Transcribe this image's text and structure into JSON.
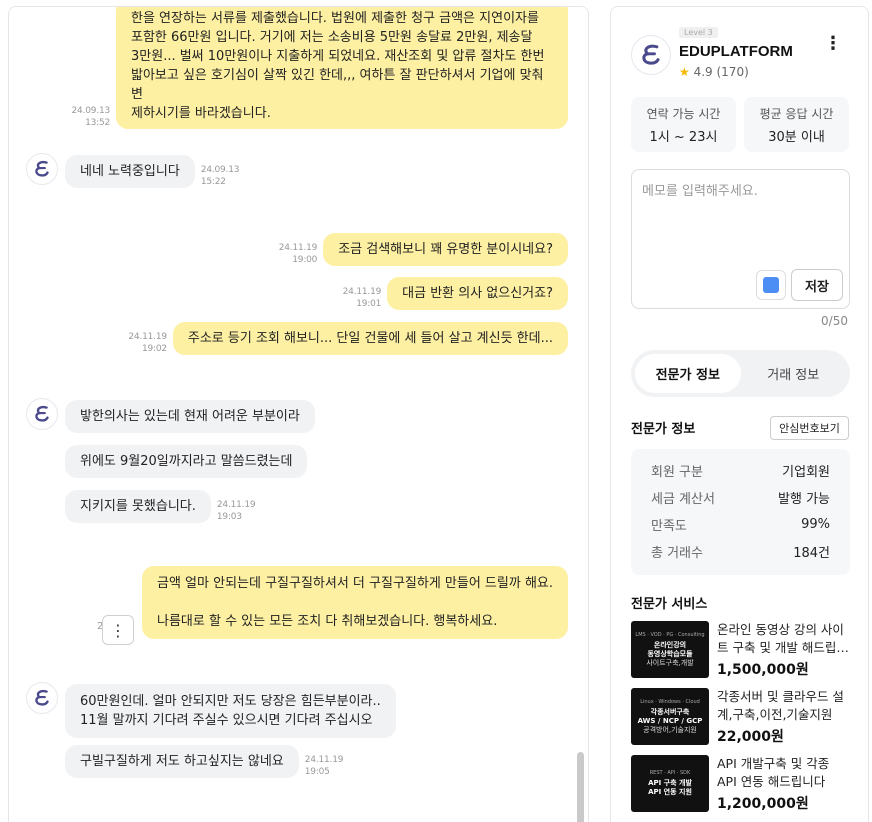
{
  "chat": {
    "messages": [
      {
        "text": "한을 연장하는 서류를 제출했습니다. 법원에 제출한 청구 금액은 지연이자를\n포함한 66만원 입니다. 거기에 저는 소송비용 5만원 송달료 2만원, 제송달\n3만원... 벌써 10만원이나 지출하게 되었네요. 재산조회 및 압류 절차도 한번\n밟아보고 싶은 호기심이 살짝 있긴 한데,,, 여하튼 잘 판단하셔서 기업에 맞춰 변\n제하시기를 바라겠습니다.",
        "date": "24.09.13",
        "time": "13:52"
      },
      {
        "text": "네네 노력중입니다",
        "date": "24.09.13",
        "time": "15:22"
      },
      {
        "text": "조금 검색해보니 꽤 유명한 분이시네요?",
        "date": "24.11.19",
        "time": "19:00"
      },
      {
        "text": "대금 반환 의사 없으신거죠?",
        "date": "24.11.19",
        "time": "19:01"
      },
      {
        "text": "주소로 등기 조회 해보니... 단일 건물에 세 들어 살고 계신듯 한데...",
        "date": "24.11.19",
        "time": "19:02"
      },
      {
        "text": "밯한의사는 있는데 현재 어려운 부분이라"
      },
      {
        "text": "위에도 9월20일까지라고 말씀드렸는데"
      },
      {
        "text": "지키지를 못했습니다.",
        "date": "24.11.19",
        "time": "19:03"
      },
      {
        "text": "금액 얼마 안되는데 구질구질하셔서 더 구질구질하게 만들어 드릴까 해요.\n\n나름대로 할 수 있는 모든 조치 다 취해보겠습니다. 행복하세요.",
        "date_partial": "2"
      },
      {
        "text": "60만원인데. 얼마 안되지만 저도 당장은 힘든부분이라..\n11월 말까지 기다려 주실수 있으시면 기다려 주십시오"
      },
      {
        "text": "구빌구질하게 저도 하고싶지는 않네요",
        "date": "24.11.19",
        "time": "19:05"
      }
    ],
    "more_icon": "⋮"
  },
  "profile": {
    "level": "Level 3",
    "name": "EDUPLATFORM",
    "rating": "4.9 (170)",
    "star_icon": "★",
    "menu_icon": "⋮",
    "contact_label": "연락 가능 시간",
    "contact_value": "1시 ~ 23시",
    "response_label": "평균 응답 시간",
    "response_value": "30분 이내",
    "memo_placeholder": "메모를 입력해주세요.",
    "memo_color": "#4d8ef5",
    "save_label": "저장",
    "memo_count": "0/50",
    "tabs": [
      "전문가 정보",
      "거래 정보"
    ],
    "info_title": "전문가 정보",
    "safe_number_label": "안심번호보기",
    "stats": [
      {
        "key": "회원 구분",
        "value": "기업회원"
      },
      {
        "key": "세금 계산서",
        "value": "발행 가능"
      },
      {
        "key": "만족도",
        "value": "99%"
      },
      {
        "key": "총 거래수",
        "value": "184건"
      }
    ],
    "services_title": "전문가 서비스",
    "services": [
      {
        "tags": "LMS · VOD · PG · Consulting",
        "thumb1": "온라인강의",
        "thumb2": "동영상학습모듈",
        "thumb3": "사이트구축,개발",
        "title": "온라인 동영상 강의 사이트 구축 및 개발 해드립니다",
        "price": "1,500,000원"
      },
      {
        "tags": "Linux · Windows · Cloud",
        "thumb1": "각종서버구축",
        "thumb2": "AWS / NCP / GCP",
        "thumb3": "공격방어,기술지원",
        "title": "각종서버 및 클라우드 설계,구축,이전,기술지원",
        "price": "22,000원"
      },
      {
        "tags": "REST · API · SDK",
        "thumb1": "API 구축 개발",
        "thumb2": "API 연동 지원",
        "thumb3": "",
        "title": "API 개발구축 및 각종 API 연동 해드립니다",
        "price": "1,200,000원"
      }
    ]
  },
  "colors": {
    "my_bubble": "#fdf0a3",
    "their_bubble": "#f1f2f4",
    "brand": "#4a4a8c"
  }
}
